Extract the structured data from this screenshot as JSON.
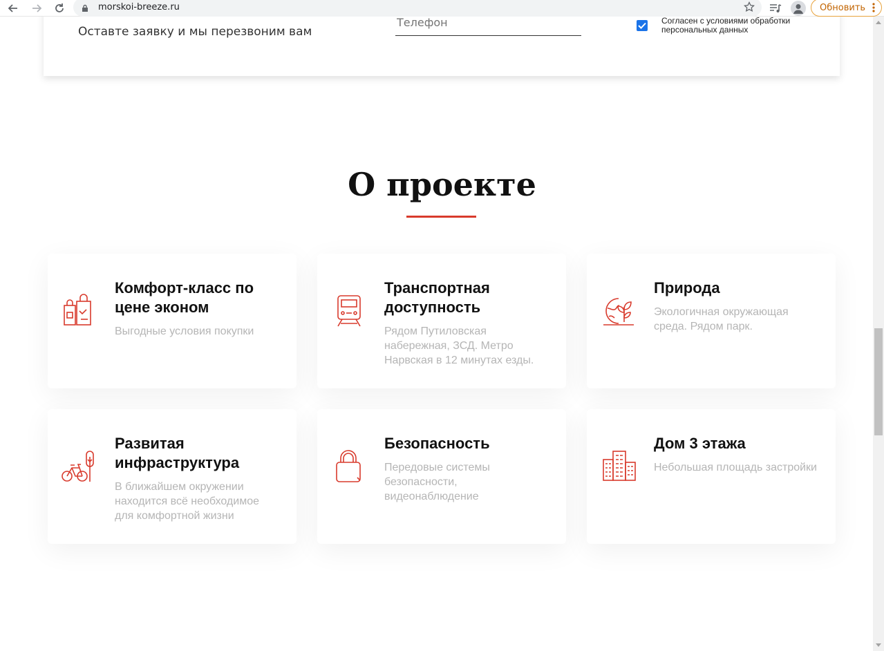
{
  "browser": {
    "url": "morskoi-breeze.ru",
    "update_label": "Обновить"
  },
  "form": {
    "callback_text": "Оставте заявку и мы перезвоним вам",
    "phone_placeholder": "Телефон",
    "agree_text": "Согласен с условиями обработки персональных данных",
    "agree_checked": true
  },
  "about": {
    "title": "О проекте",
    "accent_color": "#d83a2c",
    "features": [
      {
        "title": "Комфорт-класс по цене эконом",
        "text": "Выгодные условия покупки",
        "icon": "shopping-bags-icon"
      },
      {
        "title": "Транспортная доступность",
        "text": "Рядом Путиловская набережная, ЗСД. Метро Нарвская в 12 минутах езды.",
        "icon": "train-icon"
      },
      {
        "title": "Природа",
        "text": "Экологичная окружающая среда. Рядом парк.",
        "icon": "globe-plant-icon"
      },
      {
        "title": "Развитая инфраструктура",
        "text": "В ближайшем окружении находится всё необходимое для комфортной жизни",
        "icon": "bicycle-tree-icon"
      },
      {
        "title": "Безопасность",
        "text": "Передовые системы безопасности, видеонаблюдение",
        "icon": "padlock-icon"
      },
      {
        "title": "Дом 3 этажа",
        "text": "Небольшая площадь застройки",
        "icon": "buildings-icon"
      }
    ]
  }
}
